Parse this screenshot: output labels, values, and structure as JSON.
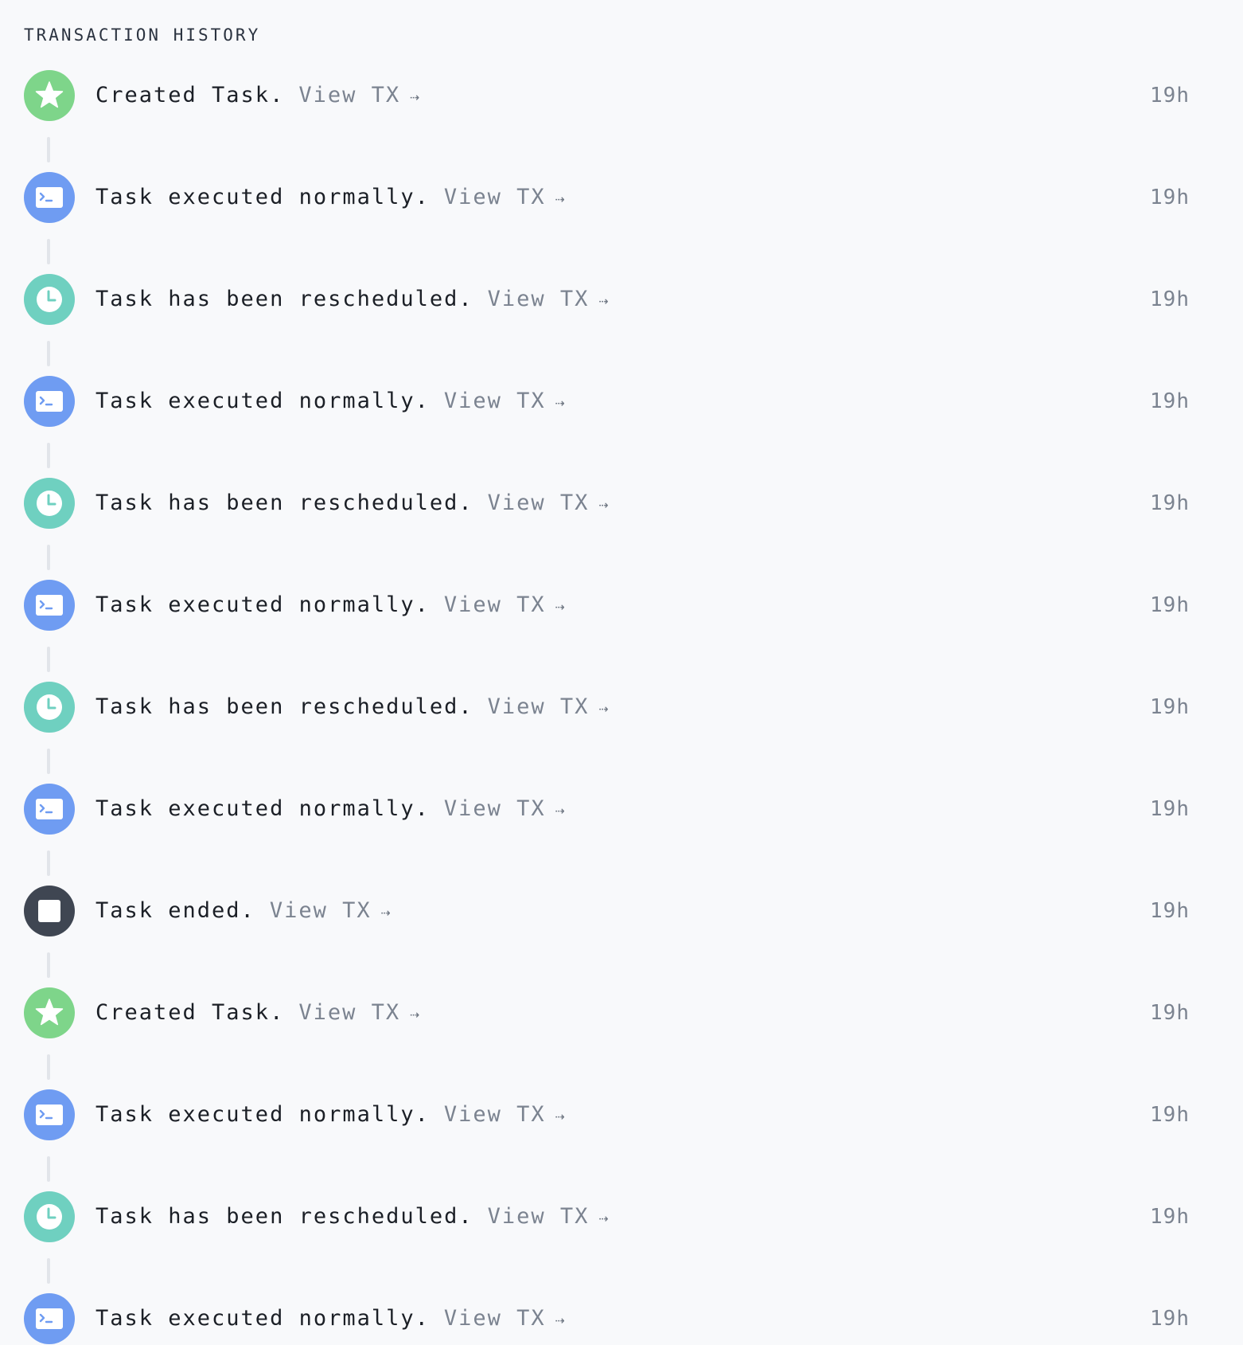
{
  "header": {
    "title": "TRANSACTION HISTORY"
  },
  "colors": {
    "created": "#7ed58a",
    "executed": "#6f9cf2",
    "rescheduled": "#6fd0c0",
    "ended": "#3f4652"
  },
  "events": [
    {
      "type": "created",
      "icon": "star-icon",
      "title": "Created Task.",
      "link": "View TX",
      "arrow": "⇢",
      "time": "19h"
    },
    {
      "type": "executed",
      "icon": "terminal-icon",
      "title": "Task executed normally.",
      "link": "View TX",
      "arrow": "⇢",
      "time": "19h"
    },
    {
      "type": "rescheduled",
      "icon": "clock-icon",
      "title": "Task has been rescheduled.",
      "link": "View TX",
      "arrow": "⇢",
      "time": "19h"
    },
    {
      "type": "executed",
      "icon": "terminal-icon",
      "title": "Task executed normally.",
      "link": "View TX",
      "arrow": "⇢",
      "time": "19h"
    },
    {
      "type": "rescheduled",
      "icon": "clock-icon",
      "title": "Task has been rescheduled.",
      "link": "View TX",
      "arrow": "⇢",
      "time": "19h"
    },
    {
      "type": "executed",
      "icon": "terminal-icon",
      "title": "Task executed normally.",
      "link": "View TX",
      "arrow": "⇢",
      "time": "19h"
    },
    {
      "type": "rescheduled",
      "icon": "clock-icon",
      "title": "Task has been rescheduled.",
      "link": "View TX",
      "arrow": "⇢",
      "time": "19h"
    },
    {
      "type": "executed",
      "icon": "terminal-icon",
      "title": "Task executed normally.",
      "link": "View TX",
      "arrow": "⇢",
      "time": "19h"
    },
    {
      "type": "ended",
      "icon": "stop-icon",
      "title": "Task ended.",
      "link": "View TX",
      "arrow": "⇢",
      "time": "19h"
    },
    {
      "type": "created",
      "icon": "star-icon",
      "title": "Created Task.",
      "link": "View TX",
      "arrow": "⇢",
      "time": "19h"
    },
    {
      "type": "executed",
      "icon": "terminal-icon",
      "title": "Task executed normally.",
      "link": "View TX",
      "arrow": "⇢",
      "time": "19h"
    },
    {
      "type": "rescheduled",
      "icon": "clock-icon",
      "title": "Task has been rescheduled.",
      "link": "View TX",
      "arrow": "⇢",
      "time": "19h"
    },
    {
      "type": "executed",
      "icon": "terminal-icon",
      "title": "Task executed normally.",
      "link": "View TX",
      "arrow": "⇢",
      "time": "19h"
    }
  ]
}
